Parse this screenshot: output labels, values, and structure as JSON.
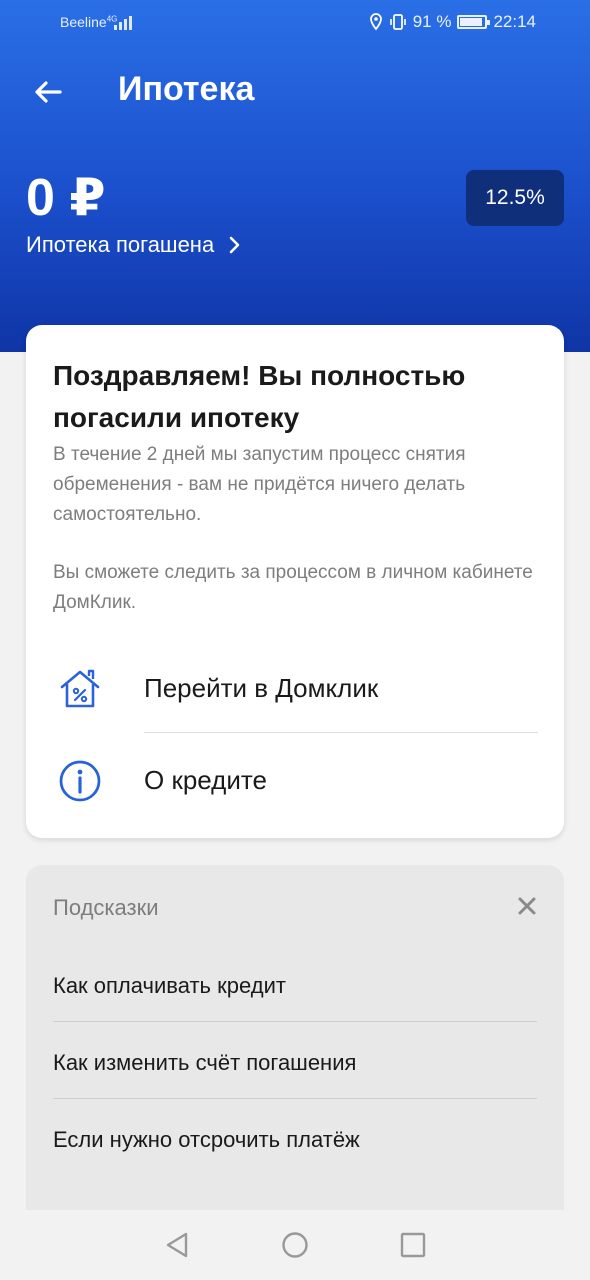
{
  "status_bar": {
    "carrier": "Beeline",
    "network": "4G",
    "battery": "91 %",
    "time": "22:14"
  },
  "header": {
    "title": "Ипотека",
    "amount": "0 ₽",
    "status": "Ипотека погашена",
    "rate": "12.5%"
  },
  "card": {
    "title": "Поздравляем! Вы полностью погасили ипотеку",
    "text1": "В течение 2 дней мы запустим процесс снятия обременения - вам не придётся ничего делать самостоятельно.",
    "text2": "Вы сможете следить за процессом в личном кабинете ДомКлик.",
    "actions": [
      {
        "label": "Перейти в Домклик",
        "icon": "house-percent-icon"
      },
      {
        "label": "О кредите",
        "icon": "info-icon"
      }
    ]
  },
  "hints": {
    "title": "Подсказки",
    "items": [
      "Как оплачивать кредит",
      "Как изменить счёт погашения",
      "Если нужно отсрочить платёж"
    ]
  },
  "colors": {
    "header_top": "#2a6fe6",
    "header_bottom": "#0f35a6",
    "badge": "#0f2f7a",
    "icon_blue": "#2a63d8"
  }
}
